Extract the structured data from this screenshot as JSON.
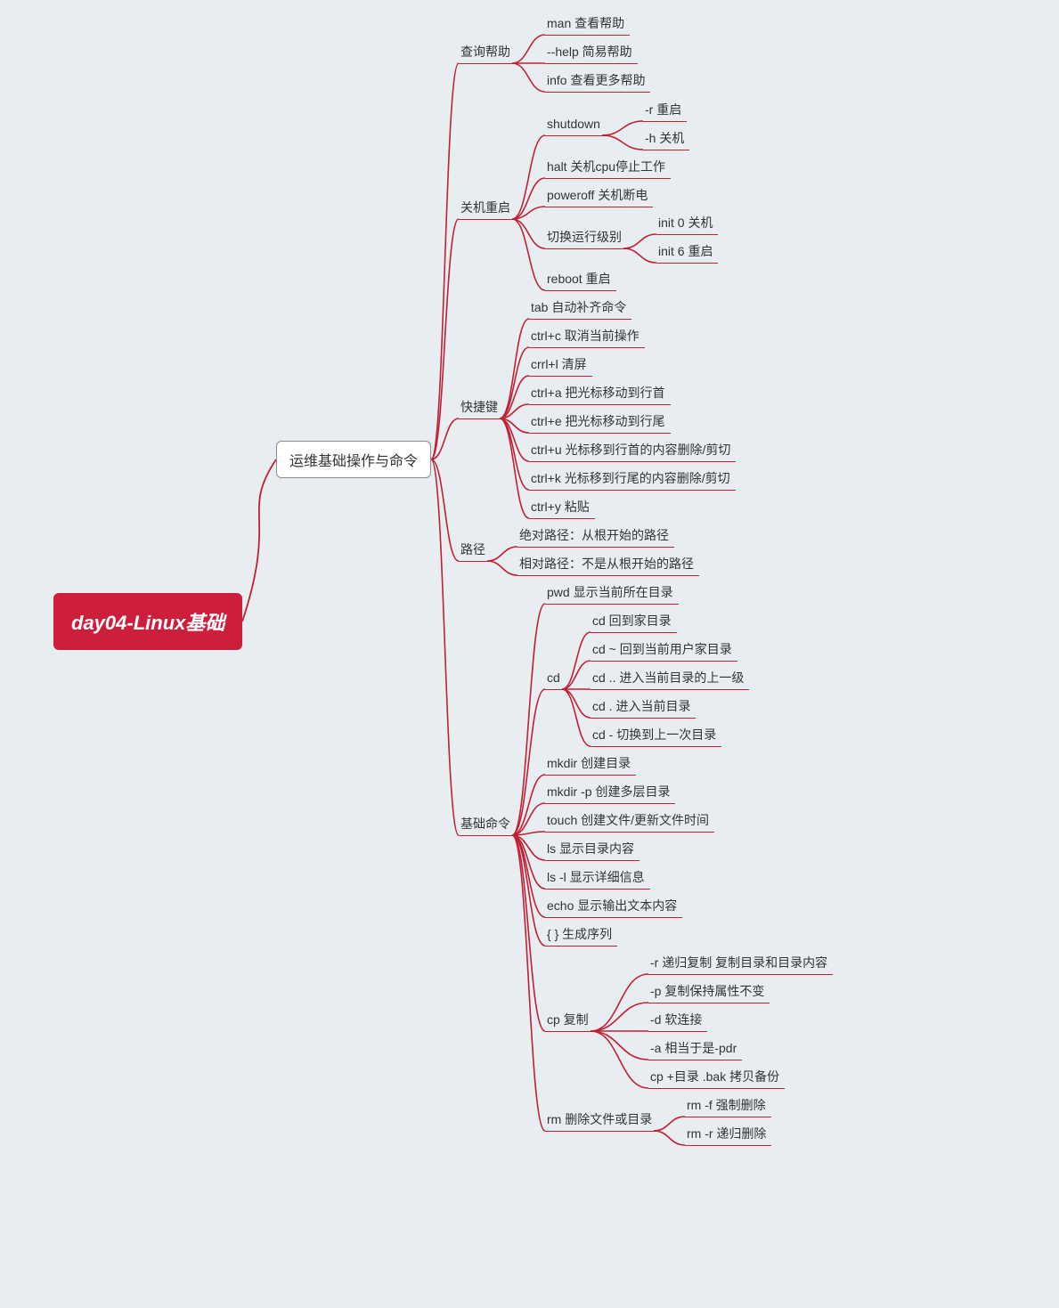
{
  "colors": {
    "accent": "#c02034",
    "root_bg": "#cd1f3c",
    "bg": "#e8edf1"
  },
  "root": "day04-Linux基础",
  "main": "运维基础操作与命令",
  "branches": {
    "help": {
      "label": "查询帮助",
      "items": [
        "man 查看帮助",
        "--help  简易帮助",
        "info 查看更多帮助"
      ]
    },
    "shutdown": {
      "label": "关机重启",
      "shutdown_lbl": "shutdown",
      "shutdown_items": [
        "-r 重启",
        "-h 关机"
      ],
      "halt": "halt 关机cpu停止工作",
      "poweroff": "poweroff 关机断电",
      "runlevel_lbl": "切换运行级别",
      "runlevel_items": [
        "init 0 关机",
        "init 6 重启"
      ],
      "reboot": "reboot  重启"
    },
    "shortcuts": {
      "label": "快捷键",
      "items": [
        "tab     自动补齐命令",
        "ctrl+c  取消当前操作",
        "crrl+l  清屏",
        "ctrl+a  把光标移动到行首",
        "ctrl+e  把光标移动到行尾",
        "ctrl+u  光标移到行首的内容删除/剪切",
        "ctrl+k  光标移到行尾的内容删除/剪切",
        "ctrl+y  粘贴"
      ]
    },
    "path": {
      "label": "路径",
      "items": [
        "绝对路径：从根开始的路径",
        "相对路径：不是从根开始的路径"
      ]
    },
    "cmds": {
      "label": "基础命令",
      "pwd": "pwd     显示当前所在目录",
      "cd_lbl": "cd",
      "cd_items": [
        "cd      回到家目录",
        "cd ~   回到当前用户家目录",
        "cd ..   进入当前目录的上一级",
        "cd .    进入当前目录",
        "cd -   切换到上一次目录"
      ],
      "mkdir": "mkdir     创建目录",
      "mkdirp": "mkdir -p 创建多层目录",
      "touch": "touch   创建文件/更新文件时间",
      "ls": "ls       显示目录内容",
      "lsl": "ls -l   显示详细信息",
      "echo": "echo    显示输出文本内容",
      "braces": "{ }          生成序列",
      "cp_lbl": "cp       复制",
      "cp_items": [
        "-r 递归复制 复制目录和目录内容",
        "-p 复制保持属性不变",
        "-d 软连接",
        "-a 相当于是-pdr",
        "cp +目录 .bak  拷贝备份"
      ],
      "rm_lbl": "rm 删除文件或目录",
      "rm_items": [
        "rm -f  强制删除",
        "rm -r  递归删除"
      ]
    }
  }
}
